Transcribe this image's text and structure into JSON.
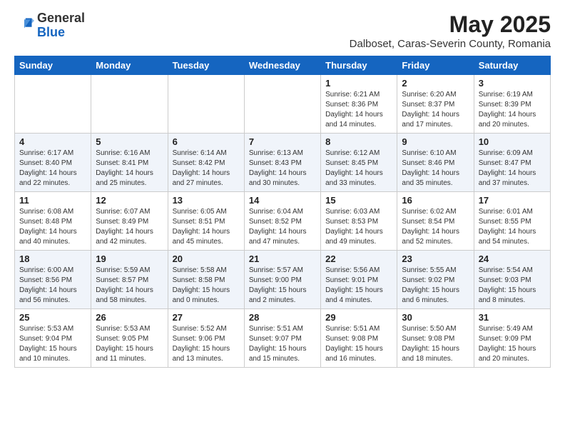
{
  "header": {
    "logo_general": "General",
    "logo_blue": "Blue",
    "main_title": "May 2025",
    "subtitle": "Dalboset, Caras-Severin County, Romania"
  },
  "weekdays": [
    "Sunday",
    "Monday",
    "Tuesday",
    "Wednesday",
    "Thursday",
    "Friday",
    "Saturday"
  ],
  "weeks": [
    [
      {
        "day": "",
        "info": ""
      },
      {
        "day": "",
        "info": ""
      },
      {
        "day": "",
        "info": ""
      },
      {
        "day": "",
        "info": ""
      },
      {
        "day": "1",
        "info": "Sunrise: 6:21 AM\nSunset: 8:36 PM\nDaylight: 14 hours and 14 minutes."
      },
      {
        "day": "2",
        "info": "Sunrise: 6:20 AM\nSunset: 8:37 PM\nDaylight: 14 hours and 17 minutes."
      },
      {
        "day": "3",
        "info": "Sunrise: 6:19 AM\nSunset: 8:39 PM\nDaylight: 14 hours and 20 minutes."
      }
    ],
    [
      {
        "day": "4",
        "info": "Sunrise: 6:17 AM\nSunset: 8:40 PM\nDaylight: 14 hours and 22 minutes."
      },
      {
        "day": "5",
        "info": "Sunrise: 6:16 AM\nSunset: 8:41 PM\nDaylight: 14 hours and 25 minutes."
      },
      {
        "day": "6",
        "info": "Sunrise: 6:14 AM\nSunset: 8:42 PM\nDaylight: 14 hours and 27 minutes."
      },
      {
        "day": "7",
        "info": "Sunrise: 6:13 AM\nSunset: 8:43 PM\nDaylight: 14 hours and 30 minutes."
      },
      {
        "day": "8",
        "info": "Sunrise: 6:12 AM\nSunset: 8:45 PM\nDaylight: 14 hours and 33 minutes."
      },
      {
        "day": "9",
        "info": "Sunrise: 6:10 AM\nSunset: 8:46 PM\nDaylight: 14 hours and 35 minutes."
      },
      {
        "day": "10",
        "info": "Sunrise: 6:09 AM\nSunset: 8:47 PM\nDaylight: 14 hours and 37 minutes."
      }
    ],
    [
      {
        "day": "11",
        "info": "Sunrise: 6:08 AM\nSunset: 8:48 PM\nDaylight: 14 hours and 40 minutes."
      },
      {
        "day": "12",
        "info": "Sunrise: 6:07 AM\nSunset: 8:49 PM\nDaylight: 14 hours and 42 minutes."
      },
      {
        "day": "13",
        "info": "Sunrise: 6:05 AM\nSunset: 8:51 PM\nDaylight: 14 hours and 45 minutes."
      },
      {
        "day": "14",
        "info": "Sunrise: 6:04 AM\nSunset: 8:52 PM\nDaylight: 14 hours and 47 minutes."
      },
      {
        "day": "15",
        "info": "Sunrise: 6:03 AM\nSunset: 8:53 PM\nDaylight: 14 hours and 49 minutes."
      },
      {
        "day": "16",
        "info": "Sunrise: 6:02 AM\nSunset: 8:54 PM\nDaylight: 14 hours and 52 minutes."
      },
      {
        "day": "17",
        "info": "Sunrise: 6:01 AM\nSunset: 8:55 PM\nDaylight: 14 hours and 54 minutes."
      }
    ],
    [
      {
        "day": "18",
        "info": "Sunrise: 6:00 AM\nSunset: 8:56 PM\nDaylight: 14 hours and 56 minutes."
      },
      {
        "day": "19",
        "info": "Sunrise: 5:59 AM\nSunset: 8:57 PM\nDaylight: 14 hours and 58 minutes."
      },
      {
        "day": "20",
        "info": "Sunrise: 5:58 AM\nSunset: 8:58 PM\nDaylight: 15 hours and 0 minutes."
      },
      {
        "day": "21",
        "info": "Sunrise: 5:57 AM\nSunset: 9:00 PM\nDaylight: 15 hours and 2 minutes."
      },
      {
        "day": "22",
        "info": "Sunrise: 5:56 AM\nSunset: 9:01 PM\nDaylight: 15 hours and 4 minutes."
      },
      {
        "day": "23",
        "info": "Sunrise: 5:55 AM\nSunset: 9:02 PM\nDaylight: 15 hours and 6 minutes."
      },
      {
        "day": "24",
        "info": "Sunrise: 5:54 AM\nSunset: 9:03 PM\nDaylight: 15 hours and 8 minutes."
      }
    ],
    [
      {
        "day": "25",
        "info": "Sunrise: 5:53 AM\nSunset: 9:04 PM\nDaylight: 15 hours and 10 minutes."
      },
      {
        "day": "26",
        "info": "Sunrise: 5:53 AM\nSunset: 9:05 PM\nDaylight: 15 hours and 11 minutes."
      },
      {
        "day": "27",
        "info": "Sunrise: 5:52 AM\nSunset: 9:06 PM\nDaylight: 15 hours and 13 minutes."
      },
      {
        "day": "28",
        "info": "Sunrise: 5:51 AM\nSunset: 9:07 PM\nDaylight: 15 hours and 15 minutes."
      },
      {
        "day": "29",
        "info": "Sunrise: 5:51 AM\nSunset: 9:08 PM\nDaylight: 15 hours and 16 minutes."
      },
      {
        "day": "30",
        "info": "Sunrise: 5:50 AM\nSunset: 9:08 PM\nDaylight: 15 hours and 18 minutes."
      },
      {
        "day": "31",
        "info": "Sunrise: 5:49 AM\nSunset: 9:09 PM\nDaylight: 15 hours and 20 minutes."
      }
    ]
  ]
}
